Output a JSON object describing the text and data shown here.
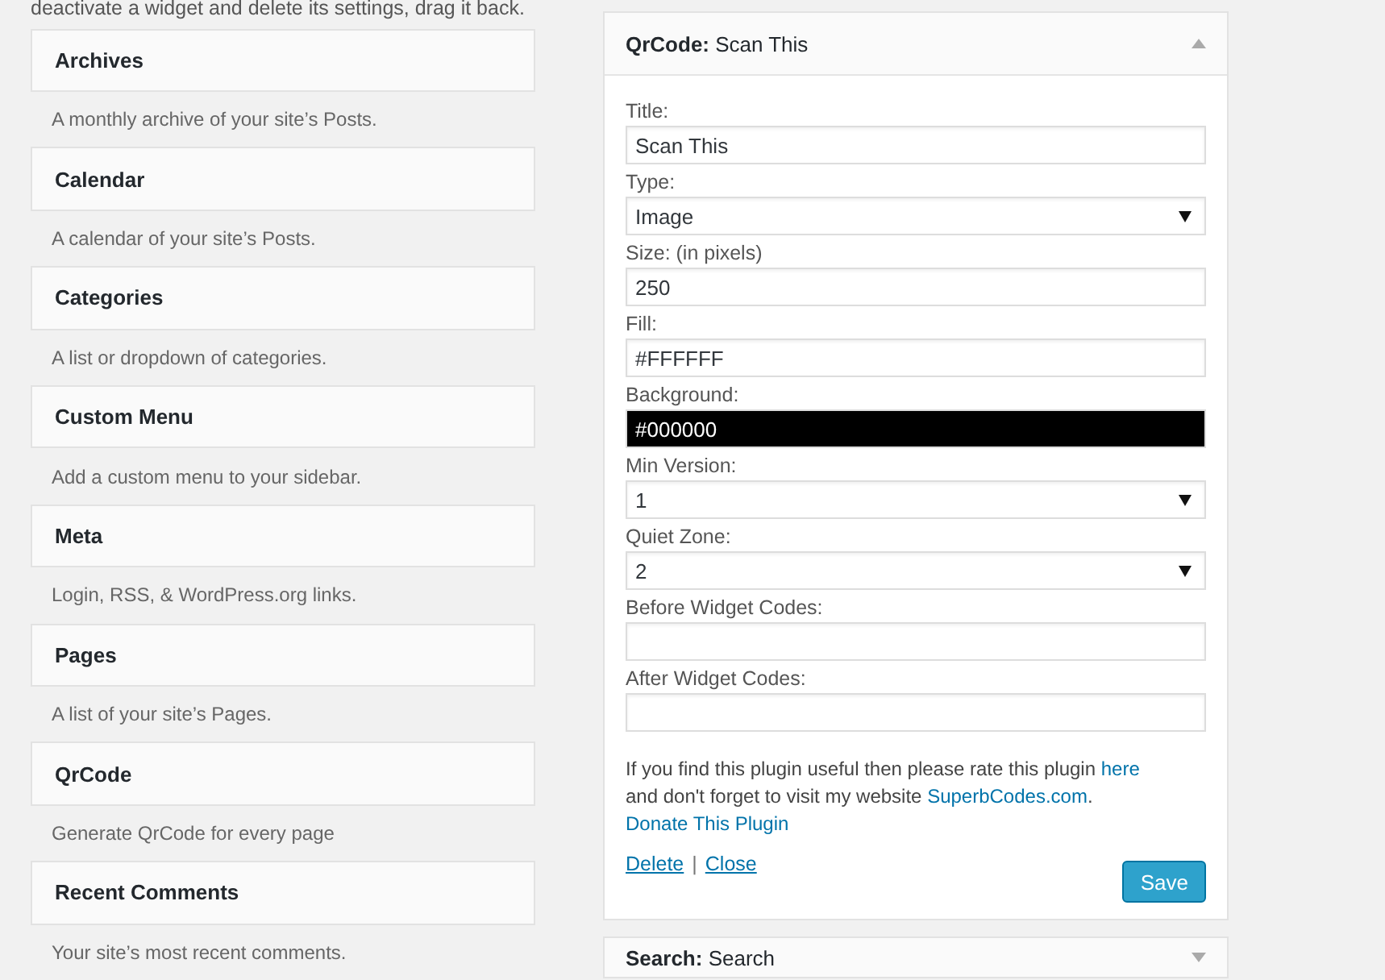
{
  "intro": "deactivate a widget and delete its settings, drag it back.",
  "available_widgets": [
    {
      "name": "Archives",
      "description": "A monthly archive of your site’s Posts."
    },
    {
      "name": "Calendar",
      "description": "A calendar of your site’s Posts."
    },
    {
      "name": "Categories",
      "description": "A list or dropdown of categories."
    },
    {
      "name": "Custom Menu",
      "description": "Add a custom menu to your sidebar."
    },
    {
      "name": "Meta",
      "description": "Login, RSS, & WordPress.org links."
    },
    {
      "name": "Pages",
      "description": "A list of your site’s Pages."
    },
    {
      "name": "QrCode",
      "description": "Generate QrCode for every page"
    },
    {
      "name": "Recent Comments",
      "description": "Your site’s most recent comments."
    }
  ],
  "open_widget": {
    "title": "**QrCode:** Scan This",
    "expanded": true,
    "fields": [
      {
        "label": "Title:",
        "kind": "text",
        "value": "Scan This"
      },
      {
        "label": "Type:",
        "kind": "select",
        "value": "Image"
      },
      {
        "label": "Size: (in pixels)",
        "kind": "text",
        "value": "250"
      },
      {
        "label": "Fill:",
        "kind": "color",
        "value": "#FFFFFF"
      },
      {
        "label": "Background:",
        "kind": "color",
        "value": "#000000"
      },
      {
        "label": "Min Version:",
        "kind": "select",
        "value": "1"
      },
      {
        "label": "Quiet Zone:",
        "kind": "select",
        "value": "2"
      },
      {
        "label": "Before Widget Codes:",
        "kind": "text"
      },
      {
        "label": "After Widget Codes:",
        "kind": "text"
      }
    ],
    "note": [
      {
        "text": "If you find this plugin useful then please rate this plugin ",
        "kind": "text"
      },
      {
        "text": "here",
        "kind": "link"
      },
      {
        "text": " and don't forget to visit my website ",
        "kind": "text"
      },
      {
        "text": "SuperbCodes.com",
        "kind": "link"
      },
      {
        "text": ".",
        "kind": "text"
      }
    ],
    "donate_link": "Donate This Plugin",
    "actions": [
      "Delete",
      "Close"
    ],
    "separator": "|",
    "save_button": "Save"
  },
  "next_widget": {
    "title": "**Search:** Search",
    "expanded": false
  }
}
